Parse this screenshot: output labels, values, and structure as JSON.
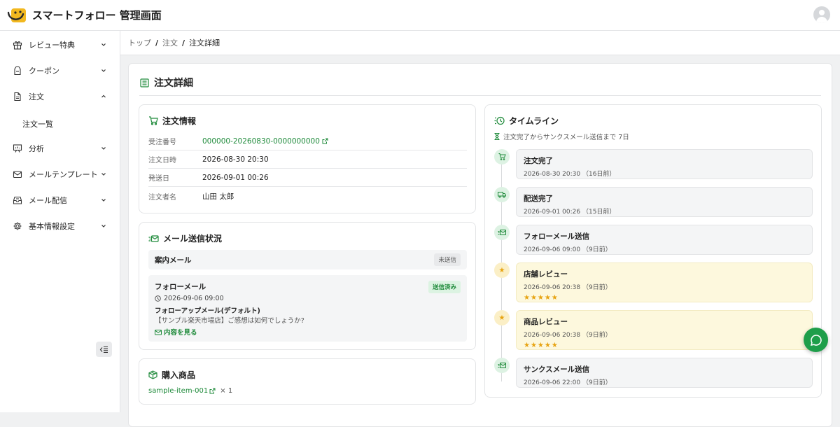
{
  "app": {
    "title": "スマートフォロー 管理画面"
  },
  "sidebar": {
    "items": [
      {
        "label": "レビュー特典",
        "icon": "gift-icon"
      },
      {
        "label": "クーポン",
        "icon": "coupon-icon"
      },
      {
        "label": "注文",
        "icon": "document-icon"
      },
      {
        "label": "分析",
        "icon": "presentation-chart-icon"
      },
      {
        "label": "メールテンプレート",
        "icon": "mail-icon"
      },
      {
        "label": "メール配信",
        "icon": "mail-inbox-icon"
      },
      {
        "label": "基本情報設定",
        "icon": "gear-icon"
      }
    ],
    "sub_item": "注文一覧"
  },
  "breadcrumb": {
    "home": "トップ",
    "orders": "注文",
    "current": "注文詳細"
  },
  "page": {
    "title": "注文詳細"
  },
  "order_info": {
    "title": "注文情報",
    "rows": [
      {
        "label": "受注番号",
        "value": "000000-20260830-0000000000"
      },
      {
        "label": "注文日時",
        "value": "2026-08-30 20:30"
      },
      {
        "label": "発送日",
        "value": "2026-09-01 00:26"
      },
      {
        "label": "注文者名",
        "value": "山田 太郎"
      }
    ]
  },
  "mail_status": {
    "title": "メール送信状況",
    "guide": {
      "name": "案内メール",
      "status": "未送信"
    },
    "follow": {
      "name": "フォローメール",
      "status": "送信済み",
      "time": "2026-09-06 09:00",
      "template": "フォローアップメール(デフォルト)",
      "subject": "【サンプル楽天市場店】ご感想は如何でしょうか?",
      "view_link": "内容を見る"
    }
  },
  "products": {
    "title": "購入商品",
    "items": [
      {
        "name": "sample-item-001",
        "qty": "× 1"
      }
    ]
  },
  "timeline": {
    "title": "タイムライン",
    "note": "注文完了からサンクスメール送信まで 7日",
    "events": [
      {
        "title": "注文完了",
        "time": "2026-08-30 20:30",
        "ago": "（16日前）",
        "icon": "cart-check-icon",
        "stars": ""
      },
      {
        "title": "配送完了",
        "time": "2026-09-01 00:26",
        "ago": "（15日前）",
        "icon": "truck-icon",
        "stars": ""
      },
      {
        "title": "フォローメール送信",
        "time": "2026-09-06 09:00",
        "ago": "（9日前）",
        "icon": "mail-send-icon",
        "stars": ""
      },
      {
        "title": "店舗レビュー",
        "time": "2026-09-06 20:38",
        "ago": "（9日前）",
        "icon": "star-icon",
        "stars": "★★★★★"
      },
      {
        "title": "商品レビュー",
        "time": "2026-09-06 20:38",
        "ago": "（9日前）",
        "icon": "star-icon",
        "stars": "★★★★★"
      },
      {
        "title": "サンクスメール送信",
        "time": "2026-09-06 22:00",
        "ago": "（9日前）",
        "icon": "mail-send-icon",
        "stars": ""
      }
    ]
  },
  "colors": {
    "accent": "#1e8a3a",
    "fab": "#1e9e4a",
    "star": "#e7a311",
    "highlight": "#fdf8dd"
  }
}
